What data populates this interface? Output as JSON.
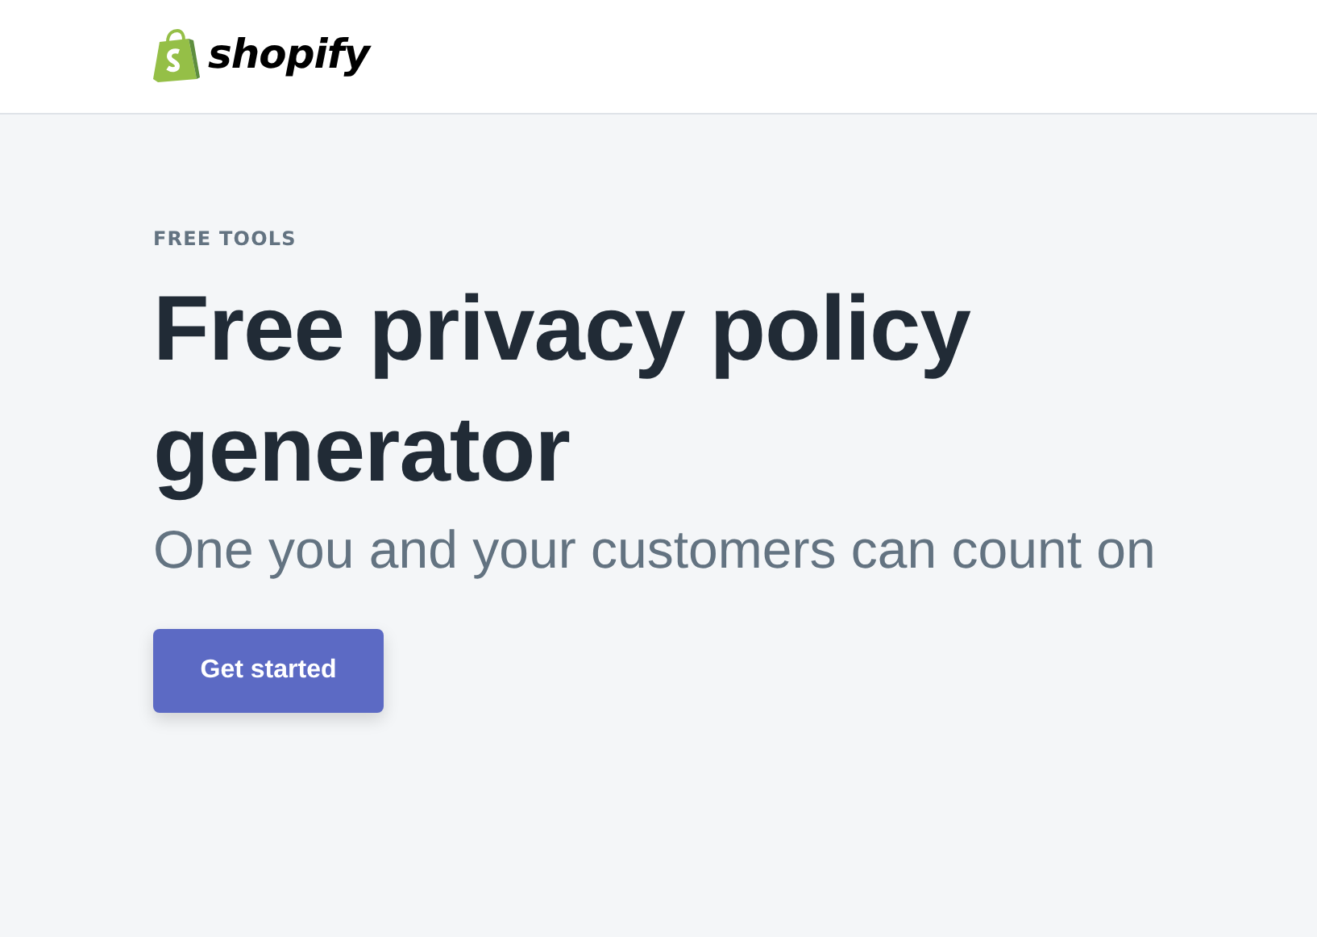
{
  "header": {
    "logo_text": "shopify"
  },
  "hero": {
    "eyebrow": "FREE TOOLS",
    "title": "Free privacy policy generator",
    "subtitle": "One you and your customers can count on",
    "button": "Get started"
  }
}
